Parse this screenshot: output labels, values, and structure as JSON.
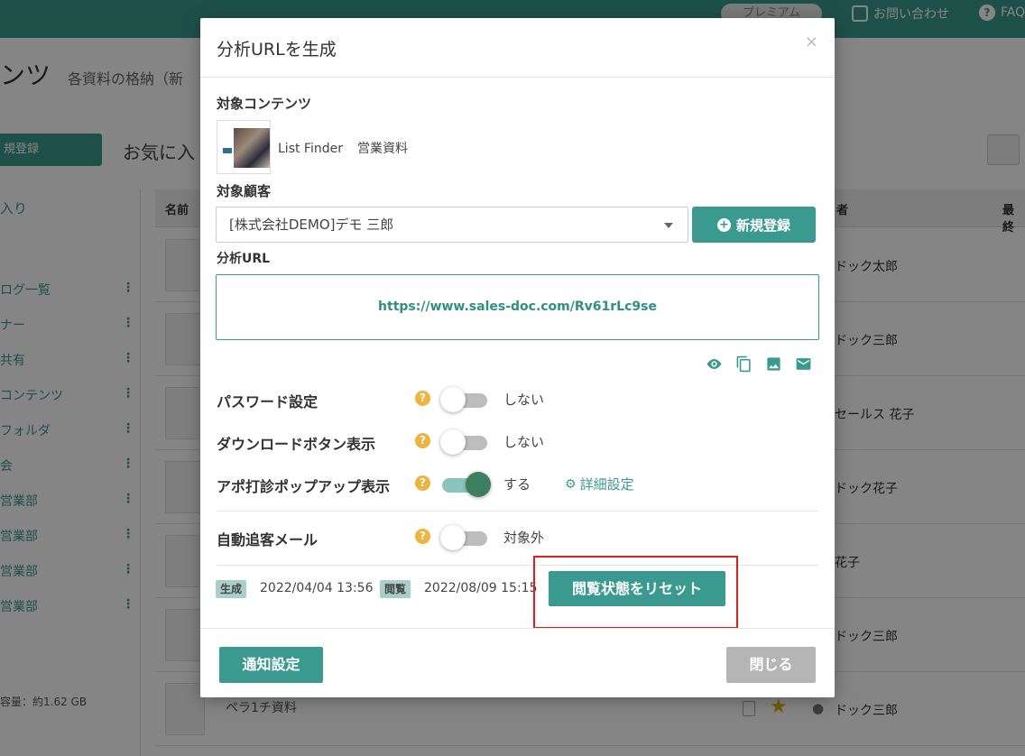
{
  "background": {
    "premium_label": "プレミアム",
    "contact_label": "お問い合わせ",
    "faq_label": "FAQ",
    "page_title": "ンツ",
    "page_subtitle": "各資料の格納（新",
    "new_button": "規登録",
    "favorites_title": "お気に入",
    "sidebar_heading": "入り",
    "sidebar_items": [
      "ログ一覧",
      "ナー",
      "共有",
      "コンテンツ",
      "フォルダ",
      "会",
      "営業部",
      "営業部",
      "営業部",
      "営業部"
    ],
    "storage": "容量：約1.62 GB",
    "table_headers": {
      "name": "名前",
      "owner": "者",
      "last": "最終"
    },
    "row_owners": [
      "ドック太郎",
      "ドック三郎",
      "セールス 花子",
      "ドック花子",
      "花子",
      "ドック三郎",
      "ドック三郎"
    ],
    "last_row_title": "ペラ1チ資料"
  },
  "modal": {
    "title": "分析URLを生成",
    "close_glyph": "×",
    "target_content_label": "対象コンテンツ",
    "content_name": "List Finder",
    "content_title": "営業資料",
    "target_customer_label": "対象顧客",
    "customer_value": "[株式会社DEMO]デモ 三郎",
    "new_register_label": "新規登録",
    "analysis_url_label": "分析URL",
    "analysis_url": "https://www.sales-doc.com/Rv61rLc9se",
    "settings": [
      {
        "label": "パスワード設定",
        "value": "しない",
        "on": false
      },
      {
        "label": "ダウンロードボタン表示",
        "value": "しない",
        "on": false
      },
      {
        "label": "アポ打診ポップアップ表示",
        "value": "する",
        "on": true
      },
      {
        "label": "自動追客メール",
        "value": "対象外",
        "on": false
      }
    ],
    "detail_settings_label": "詳細設定",
    "created_tag": "生成",
    "created_at": "2022/04/04 13:56",
    "viewed_tag": "閲覧",
    "viewed_at": "2022/08/09 15:15",
    "reset_button": "閲覧状態をリセット",
    "notify_button": "通知設定",
    "close_button": "閉じる"
  },
  "colors": {
    "brand": "#3a9a8f",
    "highlight": "#e31d1d",
    "help": "#f0b33c"
  }
}
